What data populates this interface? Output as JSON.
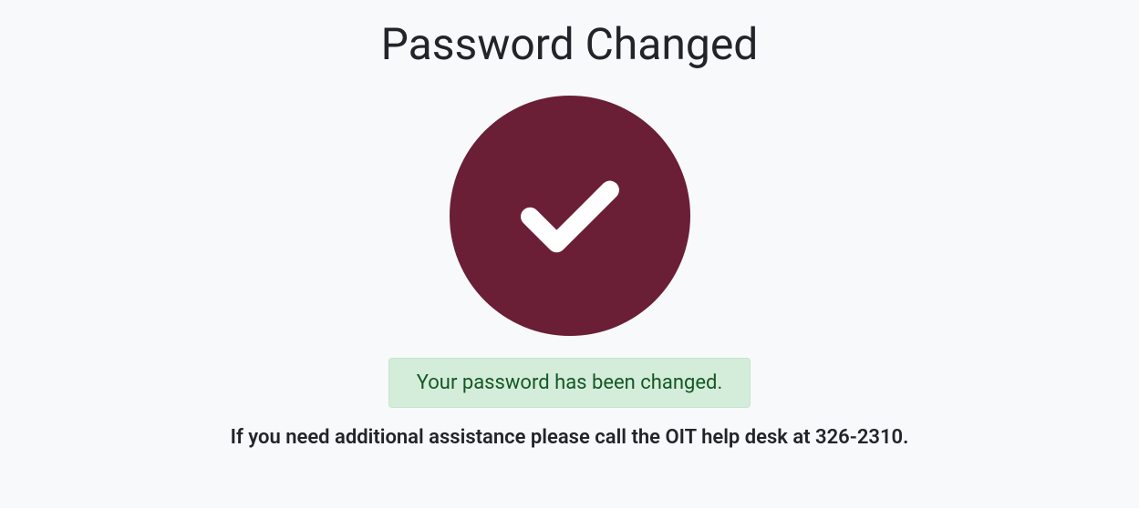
{
  "page_title": "Password Changed",
  "success_message": "Your password has been changed.",
  "help_text": "If you need additional assistance please call the OIT help desk at 326-2310.",
  "colors": {
    "circle_bg": "#6a1f36",
    "alert_bg": "#d4edda",
    "alert_text": "#155724"
  }
}
